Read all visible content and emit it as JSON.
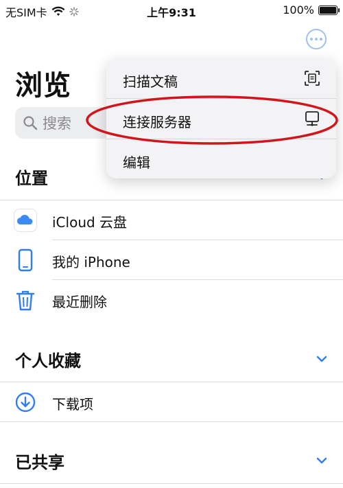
{
  "status_bar": {
    "carrier": "无SIM卡",
    "time": "上午9:31",
    "battery": "100%",
    "battery_level": 1.0,
    "icons": [
      "wifi-icon",
      "activity-spinner-icon",
      "battery-icon"
    ]
  },
  "header": {
    "title": "浏览",
    "more_icon": "ellipsis-circle-icon"
  },
  "search": {
    "placeholder": "搜索",
    "icon": "search-icon"
  },
  "locations": {
    "title": "位置",
    "items": [
      {
        "label": "iCloud 云盘",
        "icon": "icloud-icon"
      },
      {
        "label": "我的 iPhone",
        "icon": "iphone-icon"
      },
      {
        "label": "最近删除",
        "icon": "trash-icon"
      }
    ]
  },
  "favorites": {
    "title": "个人收藏",
    "items": [
      {
        "label": "下载项",
        "icon": "download-icon"
      }
    ]
  },
  "shared": {
    "title": "已共享"
  },
  "context_menu": {
    "items": [
      {
        "label": "扫描文稿",
        "icon": "document-scan-icon"
      },
      {
        "label": "连接服务器",
        "icon": "server-display-icon"
      },
      {
        "label": "编辑",
        "icon": ""
      }
    ]
  },
  "colors": {
    "accent": "#2f7cf6",
    "highlight_annotation": "#d0151b",
    "menu_background": "#f3f3f5",
    "search_background": "#ecedef"
  }
}
